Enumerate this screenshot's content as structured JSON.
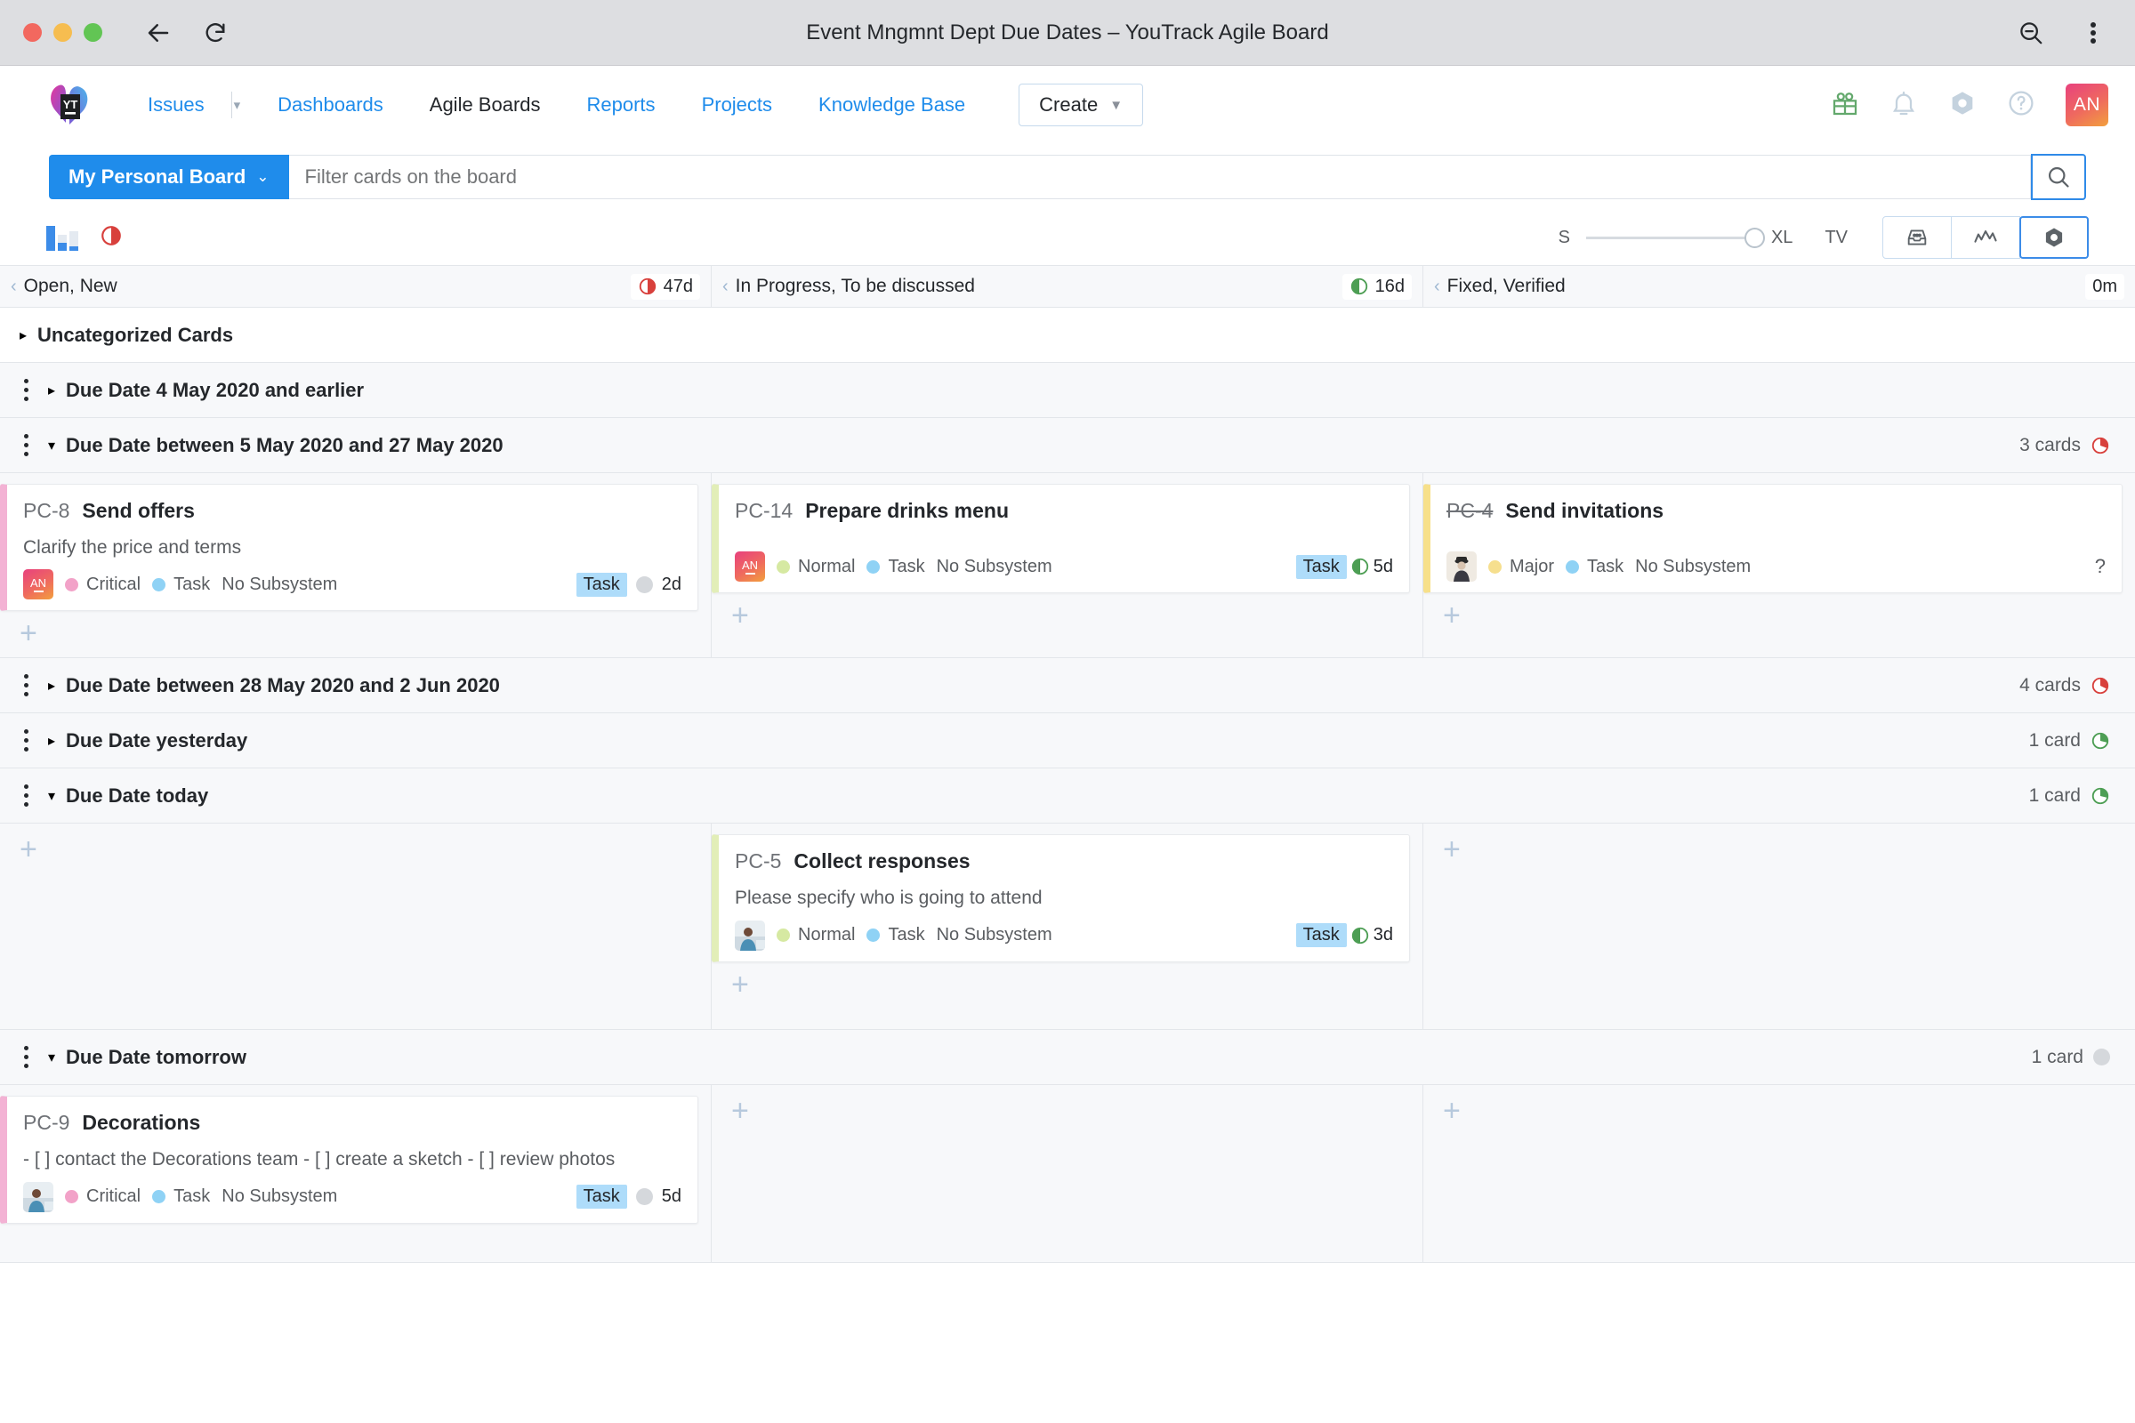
{
  "window": {
    "title": "Event Mngmnt Dept Due Dates – YouTrack Agile Board",
    "back_icon": "back-arrow-icon",
    "reload_icon": "reload-icon",
    "zoom_out_icon": "zoom-out-icon",
    "menu_icon": "kebab-menu-icon"
  },
  "header": {
    "logo": "youtrack-logo",
    "nav": [
      {
        "label": "Issues",
        "active": false,
        "has_caret": true
      },
      {
        "label": "Dashboards",
        "active": false,
        "has_caret": false
      },
      {
        "label": "Agile Boards",
        "active": true,
        "has_caret": false
      },
      {
        "label": "Reports",
        "active": false,
        "has_caret": false
      },
      {
        "label": "Projects",
        "active": false,
        "has_caret": false
      },
      {
        "label": "Knowledge Base",
        "active": false,
        "has_caret": false
      }
    ],
    "create_label": "Create",
    "icons": [
      "gift-icon",
      "bell-icon",
      "settings-nut-icon",
      "help-icon"
    ],
    "avatar_initials": "AN",
    "avatar_colors": {
      "from": "#e8417e",
      "to": "#f2a03d"
    }
  },
  "filter": {
    "board_name": "My Personal Board",
    "placeholder": "Filter cards on the board",
    "value": "",
    "search_icon": "search-icon"
  },
  "toolbar": {
    "chart_icon": "bar-chart-icon",
    "pie_icon": "red-pie-timer-icon",
    "size_min": "S",
    "size_max": "XL",
    "size_value": 100,
    "tv_label": "TV",
    "view_buttons": [
      {
        "icon": "inbox-icon",
        "selected": false
      },
      {
        "icon": "chart-line-icon",
        "selected": false
      },
      {
        "icon": "settings-nut-icon",
        "selected": true
      }
    ]
  },
  "columns": [
    {
      "title": "Open, New",
      "badge": "47d",
      "badge_icon": "red-pie-icon",
      "badge_color": "#d8403c"
    },
    {
      "title": "In Progress, To be discussed",
      "badge": "16d",
      "badge_icon": "green-pie-icon",
      "badge_color": "#4d9e54"
    },
    {
      "title": "Fixed, Verified",
      "badge": "0m",
      "badge_icon": "none",
      "badge_color": "#24272b"
    }
  ],
  "swimlanes": [
    {
      "title": "Uncategorized Cards",
      "expanded": false,
      "has_handle": false,
      "white": true,
      "count": "",
      "count_icon": "none",
      "count_color": ""
    },
    {
      "title": "Due Date 4 May 2020 and earlier",
      "expanded": false,
      "has_handle": true,
      "white": false,
      "count": "",
      "count_icon": "none",
      "count_color": ""
    },
    {
      "title": "Due Date between 5 May 2020 and 27 May 2020",
      "expanded": true,
      "has_handle": true,
      "white": false,
      "count": "3 cards",
      "count_icon": "red-pie-icon",
      "count_color": "#d8403c"
    },
    {
      "title": "Due Date between 28 May 2020 and 2 Jun 2020",
      "expanded": false,
      "has_handle": true,
      "white": false,
      "count": "4 cards",
      "count_icon": "red-pie-icon",
      "count_color": "#d8403c"
    },
    {
      "title": "Due Date yesterday",
      "expanded": false,
      "has_handle": true,
      "white": false,
      "count": "1 card",
      "count_icon": "green-pie-icon",
      "count_color": "#4d9e54"
    },
    {
      "title": "Due Date today",
      "expanded": true,
      "has_handle": true,
      "white": false,
      "count": "1 card",
      "count_icon": "green-pie-icon",
      "count_color": "#4d9e54"
    },
    {
      "title": "Due Date tomorrow",
      "expanded": true,
      "has_handle": true,
      "white": false,
      "count": "1 card",
      "count_icon": "gray-circle-icon",
      "count_color": "#d5d8dc"
    }
  ],
  "cards": {
    "pc8": {
      "id": "PC-8",
      "name": "Send offers",
      "resolved": false,
      "description": "Clarify the price and terms",
      "border_color": "#f3b2d4",
      "avatar_type": "initials",
      "avatar_initials": "AN",
      "priority": "Critical",
      "priority_color": "#f2a2c8",
      "type": "Task",
      "type_color": "#8fd2f5",
      "subsystem": "No Subsystem",
      "tag": "Task",
      "timer_icon": "gray-circle-icon",
      "estimate": "2d"
    },
    "pc14": {
      "id": "PC-14",
      "name": "Prepare drinks menu",
      "resolved": false,
      "description": "",
      "border_color": "#e2eeb8",
      "avatar_type": "initials",
      "avatar_initials": "AN",
      "priority": "Normal",
      "priority_color": "#d6e9a2",
      "type": "Task",
      "type_color": "#8fd2f5",
      "subsystem": "No Subsystem",
      "tag": "Task",
      "timer_icon": "green-pie-icon",
      "estimate": "5d"
    },
    "pc4": {
      "id": "PC-4",
      "name": "Send invitations",
      "resolved": true,
      "description": "",
      "border_color": "#f7e08a",
      "avatar_type": "photo",
      "avatar_initials": "",
      "priority": "Major",
      "priority_color": "#f6df8e",
      "type": "Task",
      "type_color": "#8fd2f5",
      "subsystem": "No Subsystem",
      "tag": "",
      "timer_icon": "none",
      "estimate": "",
      "question": "?"
    },
    "pc5": {
      "id": "PC-5",
      "name": "Collect responses",
      "resolved": false,
      "description": "Please specify who is going to attend",
      "border_color": "#e2eeb8",
      "avatar_type": "photo",
      "avatar_initials": "",
      "priority": "Normal",
      "priority_color": "#d6e9a2",
      "type": "Task",
      "type_color": "#8fd2f5",
      "subsystem": "No Subsystem",
      "tag": "Task",
      "timer_icon": "green-pie-icon",
      "estimate": "3d"
    },
    "pc9": {
      "id": "PC-9",
      "name": "Decorations",
      "resolved": false,
      "description": "- [ ] contact the Decorations team - [ ] create a sketch - [ ] review photos",
      "border_color": "#f3b2d4",
      "avatar_type": "photo",
      "avatar_initials": "",
      "priority": "Critical",
      "priority_color": "#f2a2c8",
      "type": "Task",
      "type_color": "#8fd2f5",
      "subsystem": "No Subsystem",
      "tag": "Task",
      "timer_icon": "gray-circle-icon",
      "estimate": "5d"
    }
  },
  "add_card_label": "+"
}
